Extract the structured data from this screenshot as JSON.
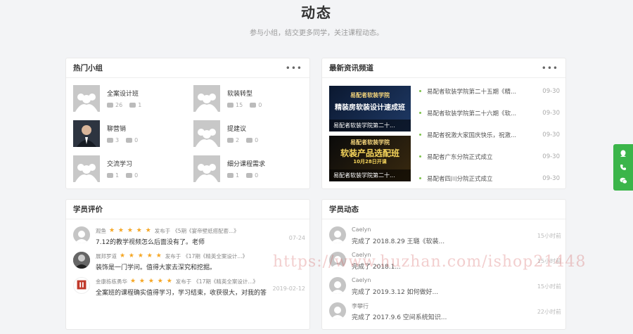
{
  "header": {
    "title": "动态",
    "subtitle": "参与小组，结交更多同学，关注课程动态。"
  },
  "hot_groups": {
    "title": "热门小组",
    "more": "•••",
    "items": [
      {
        "name": "全案设计班",
        "members": "26",
        "posts": "1",
        "photo": false
      },
      {
        "name": "软装转型",
        "members": "15",
        "posts": "0",
        "photo": false
      },
      {
        "name": "聊营销",
        "members": "3",
        "posts": "0",
        "photo": true
      },
      {
        "name": "提建议",
        "members": "2",
        "posts": "0",
        "photo": false
      },
      {
        "name": "交流学习",
        "members": "1",
        "posts": "0",
        "photo": false
      },
      {
        "name": "细分课程需求",
        "members": "1",
        "posts": "0",
        "photo": false
      }
    ]
  },
  "news": {
    "title": "最新资讯频道",
    "more": "•••",
    "images": [
      {
        "line1": "易配者软装学院",
        "line2": "精装房软装设计速成班",
        "caption": "易配者软装学院第二十..."
      },
      {
        "line1": "易配者软装学院",
        "line2": "软装产品选配班",
        "line3": "10月28日开课",
        "caption": "易配者软装学院第二十..."
      }
    ],
    "items": [
      {
        "text": "易配者软装学院第二十五期《精...",
        "date": "09-30"
      },
      {
        "text": "易配者软装学院第二十六期《软...",
        "date": "09-30"
      },
      {
        "text": "易配者祝激大家国庆快乐，祝激...",
        "date": "09-30"
      },
      {
        "text": "易配者广东分院正式成立",
        "date": "09-30"
      },
      {
        "text": "易配者四川分院正式成立",
        "date": "09-30"
      }
    ]
  },
  "reviews": {
    "title": "学员评价",
    "items": [
      {
        "user": "观鱼",
        "stars": "★ ★ ★ ★ ★",
        "published": "发布于",
        "course": "《5期《宴帝壁纸搭配套...》",
        "text": "7.12的教学视频怎么后面没有了。老师",
        "date": "07-24"
      },
      {
        "user": "展邦罗道",
        "stars": "★ ★ ★ ★ ★",
        "published": "发布于",
        "course": "《17期《精英全案设计...》",
        "text": "装饰是一门学问。值得大家去深究和挖掘。",
        "date": ""
      },
      {
        "user": "金康栋栋勇华",
        "stars": "★ ★ ★ ★ ★",
        "published": "发布于",
        "course": "《17期《精英全案设计...》",
        "text": "全案班的课程确实值得学习，学习结束，收获很大，对我的答",
        "date": "2019-02-12"
      }
    ]
  },
  "activity": {
    "title": "学员动态",
    "items": [
      {
        "user": "Caelyn",
        "text": "完成了 2018.8.29 王璐《软装...",
        "time": "15小时前"
      },
      {
        "user": "Caelyn",
        "text": "完成了 2018.1...",
        "time": "15小时前"
      },
      {
        "user": "Caelyn",
        "text": "完成了 2019.3.12 如何做好...",
        "time": "15小时前"
      },
      {
        "user": "李攀行",
        "text": "完成了 2017.9.6 空间系统知识...",
        "time": "22小时前"
      }
    ]
  },
  "watermark": "https://www.huzhan.com/ishop21448",
  "colors": {
    "accent": "#3bb54a",
    "star": "#f5a623",
    "dot": "#7dc24b"
  }
}
